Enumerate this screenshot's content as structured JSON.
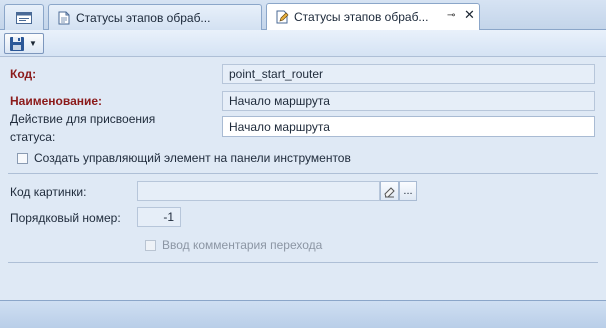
{
  "tabs": [
    {
      "label": "Статусы этапов обраб..."
    },
    {
      "label": "Статусы этапов обраб..."
    }
  ],
  "toolbar": {
    "save_label": "",
    "dropdown_label": ""
  },
  "form": {
    "code": {
      "label": "Код:",
      "value": "point_start_router"
    },
    "name": {
      "label": "Наименование:",
      "value": "Начало маршрута"
    },
    "action": {
      "label_line1": "Действие для присвоения",
      "label_line2": "статуса:",
      "value": "Начало маршрута"
    },
    "create_toolbar_element": {
      "label": "Создать управляющий элемент на панели инструментов",
      "checked": false
    },
    "image_code": {
      "label": "Код картинки:",
      "value": "",
      "browse_label": "..."
    },
    "order": {
      "label": "Порядковый номер:",
      "value": "-1"
    },
    "transition_comment": {
      "label": "Ввод комментария перехода",
      "checked": false,
      "enabled": false
    }
  },
  "colors": {
    "required_label": "#8b1a1a",
    "panel_bg": "#dfe9f5",
    "accent": "#2b5797"
  }
}
